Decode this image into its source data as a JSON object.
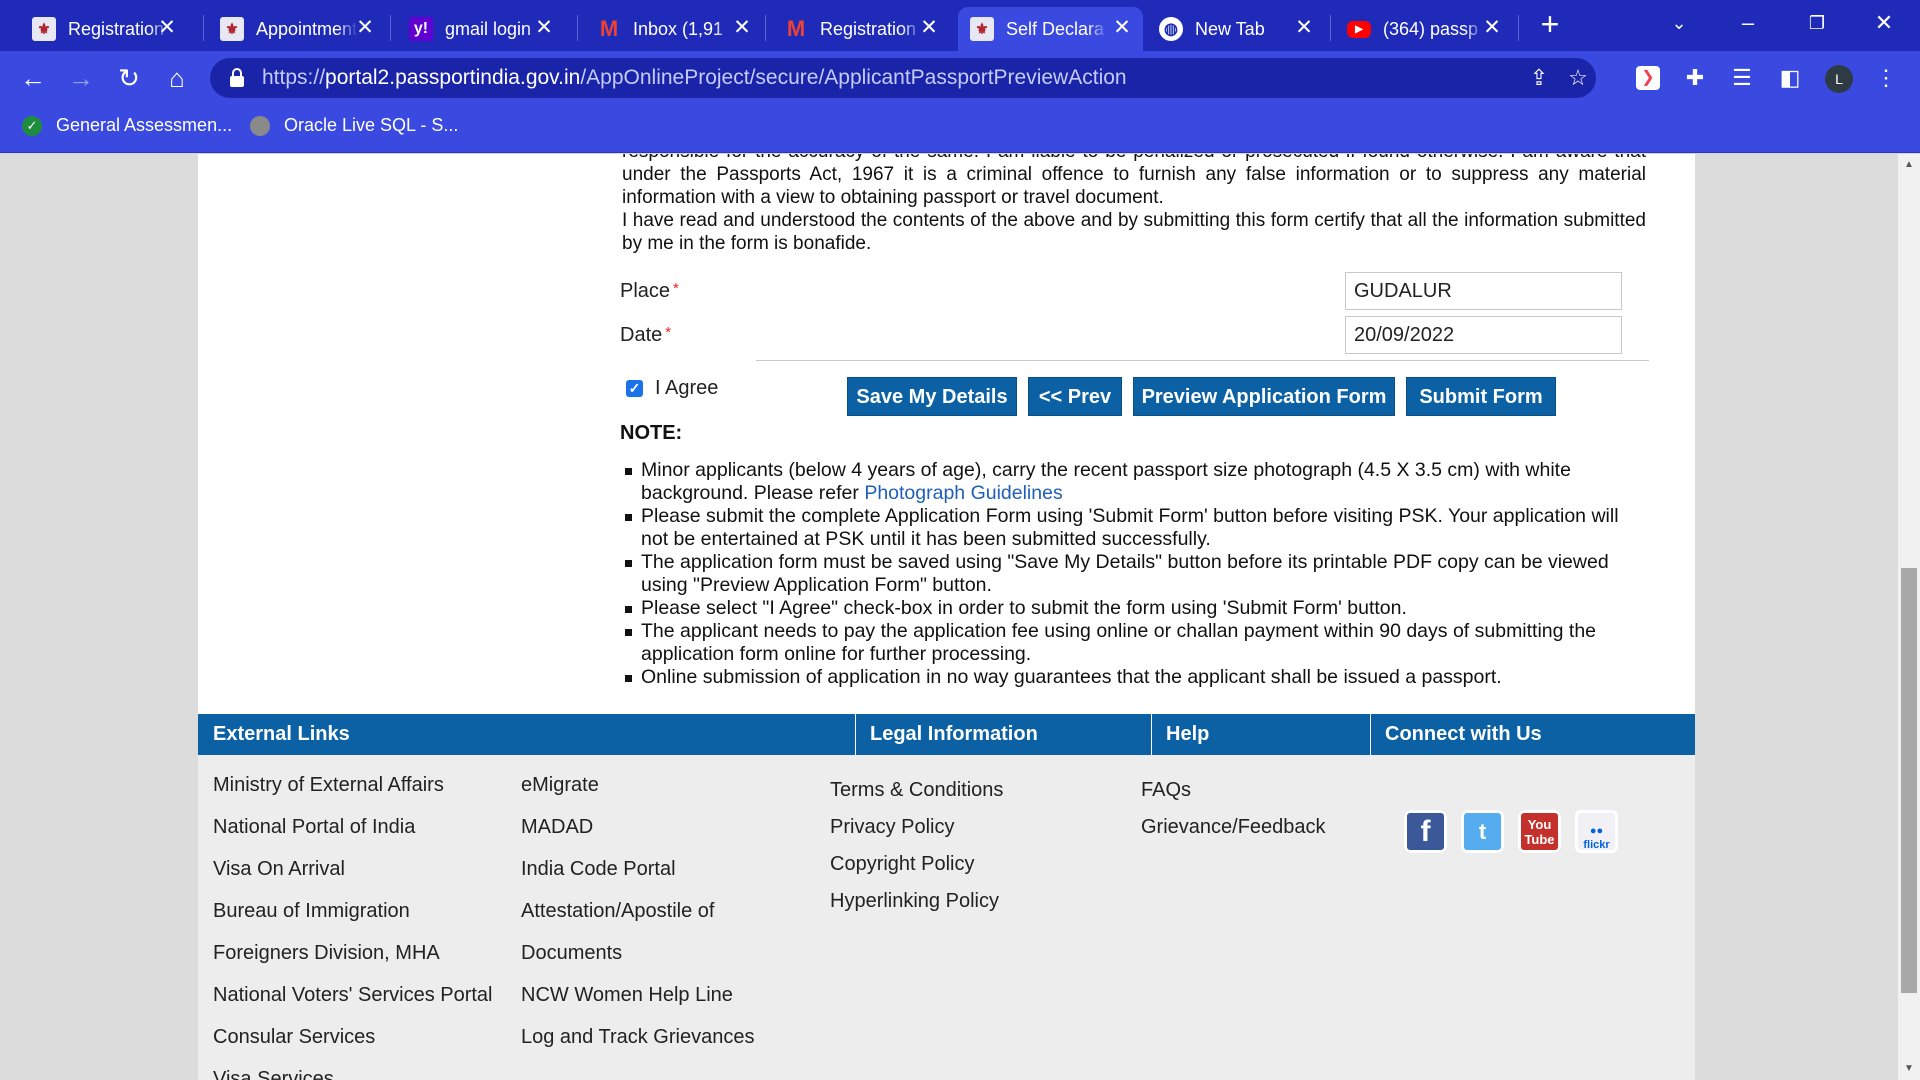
{
  "browser": {
    "tabs": [
      {
        "title": "Registration",
        "favicon": "emblem-icon"
      },
      {
        "title": "Appointment",
        "favicon": "emblem-icon"
      },
      {
        "title": "gmail login",
        "favicon": "yahoo-icon"
      },
      {
        "title": "Inbox (1,91",
        "favicon": "gmail-icon"
      },
      {
        "title": "Registration",
        "favicon": "gmail-icon"
      },
      {
        "title": "Self Declara",
        "favicon": "emblem-icon",
        "active": true
      },
      {
        "title": "New Tab",
        "favicon": "globe-icon"
      },
      {
        "title": "(364) passp",
        "favicon": "youtube-icon"
      }
    ],
    "url_prefix": "https://",
    "url_domain": "portal2.passportindia.gov.in",
    "url_path": "/AppOnlineProject/secure/ApplicantPassportPreviewAction",
    "bookmarks": [
      {
        "label": "General Assessmen...",
        "icon": "check-circle-icon"
      },
      {
        "label": "Oracle Live SQL - S...",
        "icon": "oracle-icon"
      }
    ],
    "profile_initial": "L",
    "colors": {
      "chrome": "#3a49e0",
      "tabstrip": "#1f2ab8"
    }
  },
  "declaration": {
    "lines": [
      "responsible for the accuracy of the same. I am liable to be penalized or prosecuted if found otherwise. I am aware that under the Passports Act, 1967 it is a criminal offence to furnish any false information or to suppress any material information with a view to obtaining passport or travel document.",
      "I have read and understood the contents of the above and by submitting this form certify that all the information submitted by me in the form is bonafide."
    ]
  },
  "form": {
    "place_label": "Place",
    "place_value": "GUDALUR",
    "date_label": "Date",
    "date_value": "20/09/2022",
    "required_mark": "*",
    "agree_label": "I Agree",
    "agree_checked": true
  },
  "buttons": {
    "save": "Save My Details",
    "prev": "<< Prev",
    "preview": "Preview Application Form",
    "submit": "Submit Form"
  },
  "note": {
    "heading": "NOTE:",
    "item1_text": "Minor applicants (below 4 years of age), carry the recent passport size photograph (4.5 X 3.5 cm) with white background. Please refer ",
    "item1_link": "Photograph Guidelines",
    "items": [
      "Please submit the complete Application Form using 'Submit Form' button before visiting PSK. Your application will not be entertained at PSK until it has been submitted successfully.",
      "The application form must be saved using \"Save My Details\" button before its printable PDF copy can be viewed using \"Preview Application Form\" button.",
      "Please select \"I Agree\" check-box in order to submit the form using 'Submit Form' button.",
      "The applicant needs to pay the application fee using online or challan payment within 90 days of submitting the application form online for further processing.",
      "Online submission of application in no way guarantees that the applicant shall be issued a passport."
    ]
  },
  "footer": {
    "headings": {
      "external": "External Links",
      "legal": "Legal Information",
      "help": "Help",
      "connect": "Connect with Us"
    },
    "external_col1": [
      "Ministry of External Affairs",
      "National Portal of India",
      "Visa On Arrival",
      "Bureau of Immigration",
      "Foreigners Division, MHA",
      "National Voters' Services Portal",
      "Consular Services",
      "Visa Services"
    ],
    "external_col2": [
      "eMigrate",
      "MADAD",
      "India Code Portal",
      "Attestation/Apostile of",
      "Documents",
      "NCW Women Help Line",
      "Log and Track Grievances"
    ],
    "legal": [
      "Terms & Conditions",
      "Privacy Policy",
      "Copyright Policy",
      "Hyperlinking Policy"
    ],
    "help": [
      "FAQs",
      "Grievance/Feedback"
    ],
    "social": [
      "facebook-icon",
      "twitter-icon",
      "youtube-icon",
      "flickr-icon"
    ],
    "colors": {
      "bar": "#0b61a4",
      "body": "#ededed"
    }
  }
}
